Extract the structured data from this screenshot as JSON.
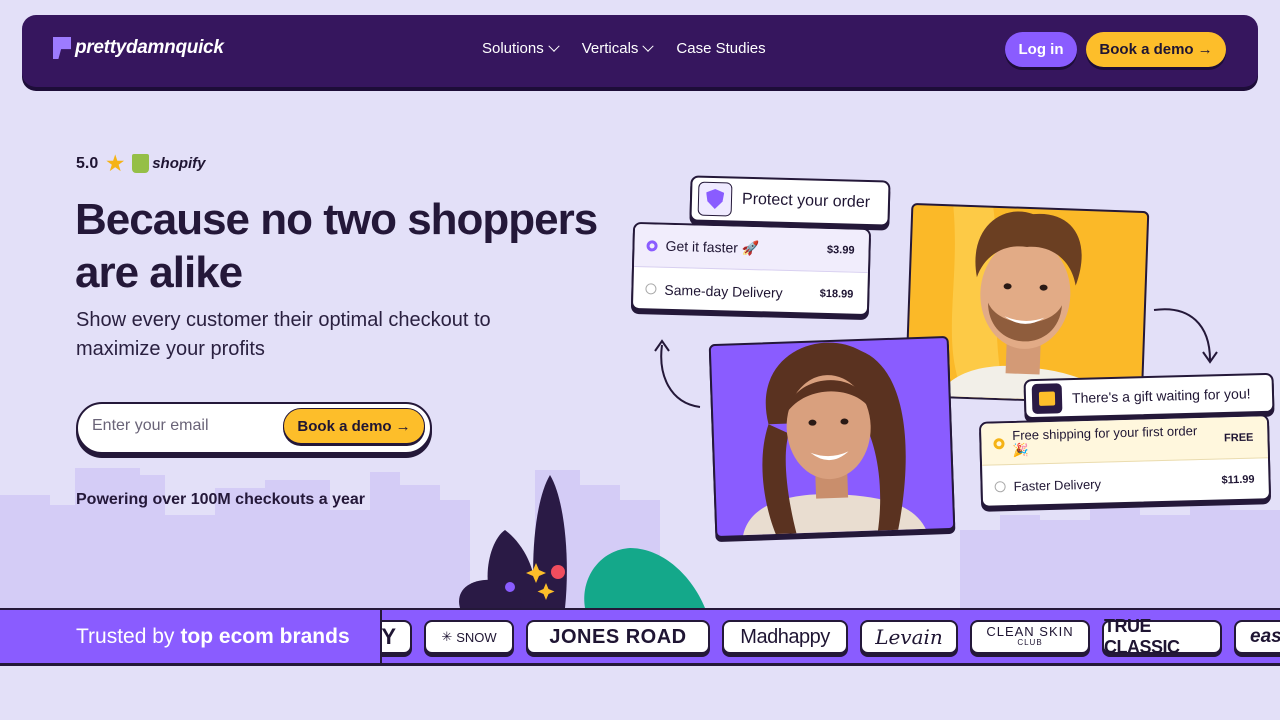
{
  "nav": {
    "logo_text": "prettydamnquick",
    "links": [
      {
        "label": "Solutions",
        "has_dropdown": true
      },
      {
        "label": "Verticals",
        "has_dropdown": true
      },
      {
        "label": "Case Studies",
        "has_dropdown": false
      }
    ],
    "login_label": "Log in",
    "demo_label": "Book a demo",
    "arrow": "→"
  },
  "hero": {
    "rating": "5.0",
    "rating_icon": "star-icon",
    "platform": "shopify",
    "headline": "Because no two shoppers are alike",
    "subheadline": "Show every customer their optimal checkout to maximize your profits",
    "email_placeholder": "Enter your email",
    "demo_label": "Book a demo",
    "arrow": "→",
    "powering": "Powering over 100M checkouts a year"
  },
  "checkout_demo": {
    "protect_title": "Protect your order",
    "shipping_options": [
      {
        "label": "Get it faster 🚀",
        "price": "$3.99",
        "selected": true
      },
      {
        "label": "Same-day Delivery",
        "price": "$18.99",
        "selected": false
      }
    ],
    "gift_title": "There's a gift waiting for you!",
    "gift_options": [
      {
        "label": "Free shipping for your first order 🎉",
        "price": "FREE",
        "selected": true
      },
      {
        "label": "Faster Delivery",
        "price": "$11.99",
        "selected": false
      }
    ]
  },
  "trust": {
    "prefix": "Trusted by",
    "highlight": "top ecom brands",
    "brands": [
      "Y",
      "SNOW",
      "JONES ROAD",
      "Madhappy",
      "Levain",
      "CLEAN SKIN",
      "CLUB",
      "TRUE CLASSIC",
      "eas"
    ]
  },
  "colors": {
    "nav_bg": "#36165e",
    "accent_purple": "#8a5cff",
    "accent_yellow": "#fdbe2a",
    "page_bg": "#e3e0f8",
    "ink": "#241839"
  }
}
